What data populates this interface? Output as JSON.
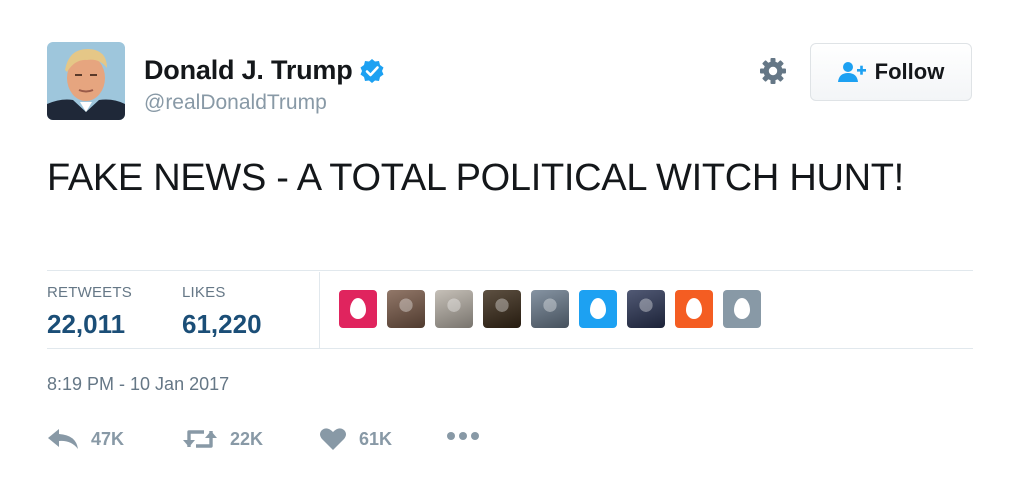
{
  "user": {
    "display_name": "Donald J. Trump",
    "handle": "@realDonaldTrump",
    "verified": true
  },
  "header": {
    "follow_label": "Follow"
  },
  "tweet": {
    "text": "FAKE NEWS - A TOTAL POLITICAL WITCH HUNT!",
    "timestamp": "8:19 PM - 10 Jan 2017"
  },
  "stats": {
    "retweets_label": "RETWEETS",
    "retweets_value": "22,011",
    "likes_label": "LIKES",
    "likes_value": "61,220"
  },
  "likers": [
    {
      "kind": "egg",
      "color": "#e0245e"
    },
    {
      "kind": "photo",
      "color": "#7a5a48"
    },
    {
      "kind": "photo",
      "color": "#b9b2a8"
    },
    {
      "kind": "photo",
      "color": "#3a2a18"
    },
    {
      "kind": "photo",
      "color": "#6b7c8e"
    },
    {
      "kind": "egg",
      "color": "#1da1f2"
    },
    {
      "kind": "photo",
      "color": "#2b3556"
    },
    {
      "kind": "egg",
      "color": "#f45d22"
    },
    {
      "kind": "egg",
      "color": "#8899a6"
    }
  ],
  "actions": {
    "reply_count": "47K",
    "retweet_count": "22K",
    "like_count": "61K"
  },
  "colors": {
    "verified": "#1da1f2",
    "stat_value": "#1b4e77",
    "muted": "#8899a6"
  }
}
